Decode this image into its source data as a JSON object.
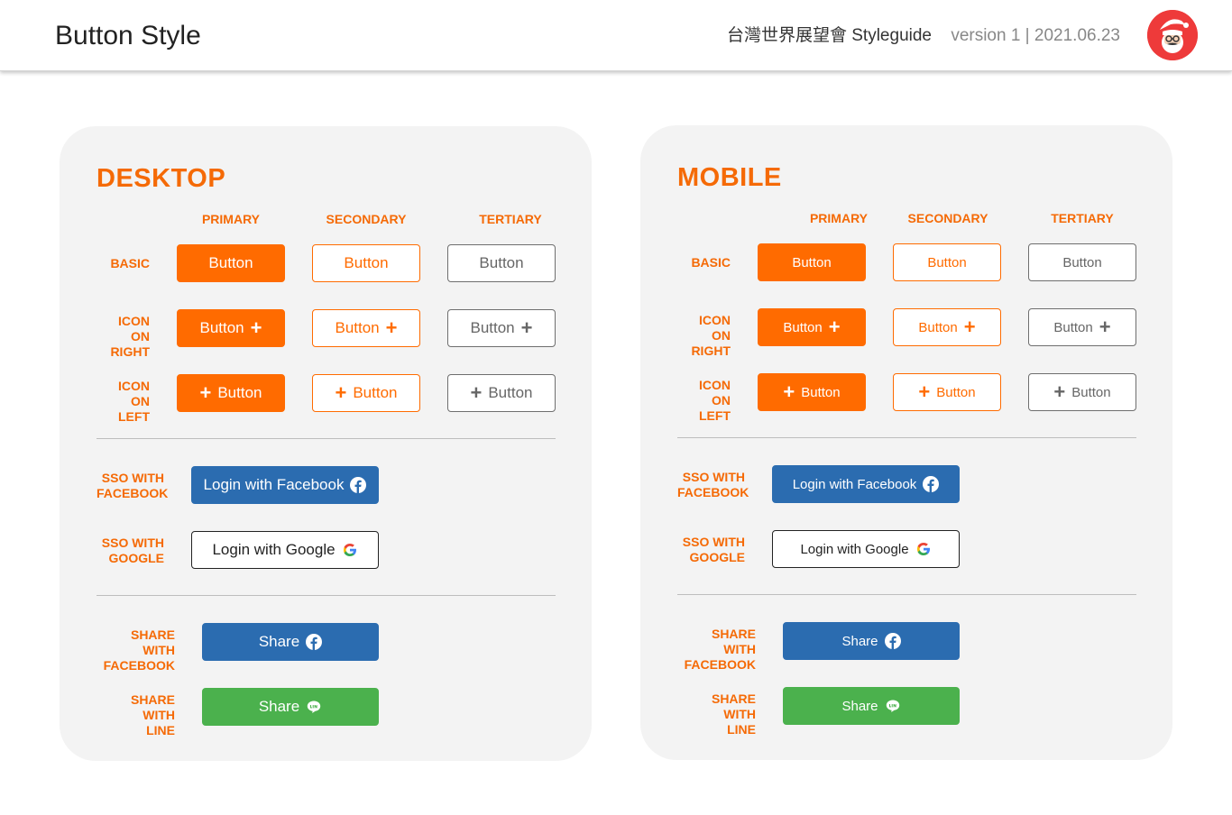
{
  "header": {
    "title": "Button Style",
    "guide": "台灣世界展望會 Styleguide",
    "version": "version 1 | 2021.06.23"
  },
  "colors": {
    "accent": "#ff6b00",
    "facebook": "#2b6cb0",
    "line": "#4bb14d",
    "tertiary_border": "#6e6e6e"
  },
  "columns": {
    "primary": "PRIMARY",
    "secondary": "SECONDARY",
    "tertiary": "TERTIARY"
  },
  "labels": {
    "basic": "BASIC",
    "icon_right_1": "ICON ON",
    "icon_right_2": "RIGHT",
    "icon_left_1": "ICON ON",
    "icon_left_2": "LEFT",
    "sso_fb_1": "SSO WITH",
    "sso_fb_2": "FACEBOOK",
    "sso_google_1": "SSO WITH",
    "sso_google_2": "GOOGLE",
    "share_fb_1": "SHARE WITH",
    "share_fb_2": "FACEBOOK",
    "share_line_1": "SHARE WITH",
    "share_line_2": "LINE"
  },
  "buttons": {
    "text": "Button",
    "login_facebook": "Login with Facebook",
    "login_google": "Login with Google",
    "share": "Share"
  },
  "icons": {
    "plus": "plus-icon",
    "facebook": "facebook-icon",
    "google": "google-icon",
    "line": "line-icon",
    "avatar": "santa-avatar"
  },
  "panels": {
    "desktop": "DESKTOP",
    "mobile": "MOBILE"
  }
}
